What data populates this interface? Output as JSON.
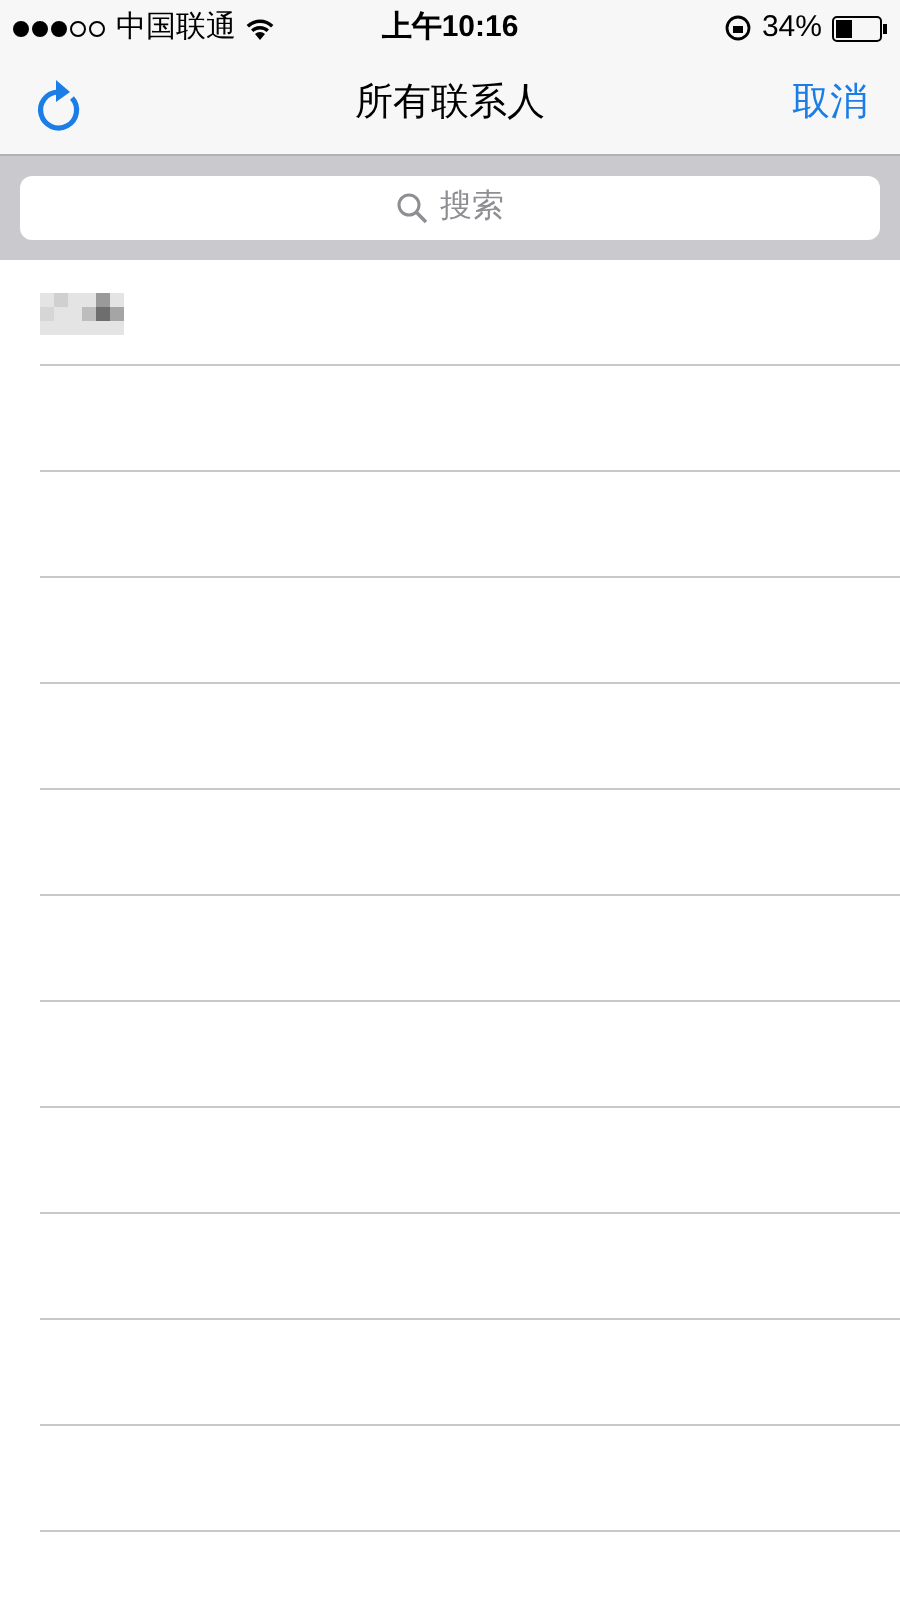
{
  "status_bar": {
    "carrier": "中国联通",
    "time": "上午10:16",
    "battery": "34%"
  },
  "nav": {
    "title": "所有联系人",
    "cancel": "取消"
  },
  "search": {
    "placeholder": "搜索"
  },
  "contacts": [
    {
      "kind": "redacted"
    },
    {
      "kind": "blank"
    },
    {
      "kind": "blank"
    },
    {
      "kind": "blank"
    },
    {
      "kind": "blank"
    },
    {
      "kind": "blank"
    },
    {
      "kind": "blank"
    },
    {
      "kind": "blank"
    },
    {
      "kind": "blank"
    },
    {
      "kind": "blank"
    },
    {
      "kind": "blank"
    },
    {
      "kind": "blank"
    },
    {
      "kind": "blank"
    }
  ]
}
